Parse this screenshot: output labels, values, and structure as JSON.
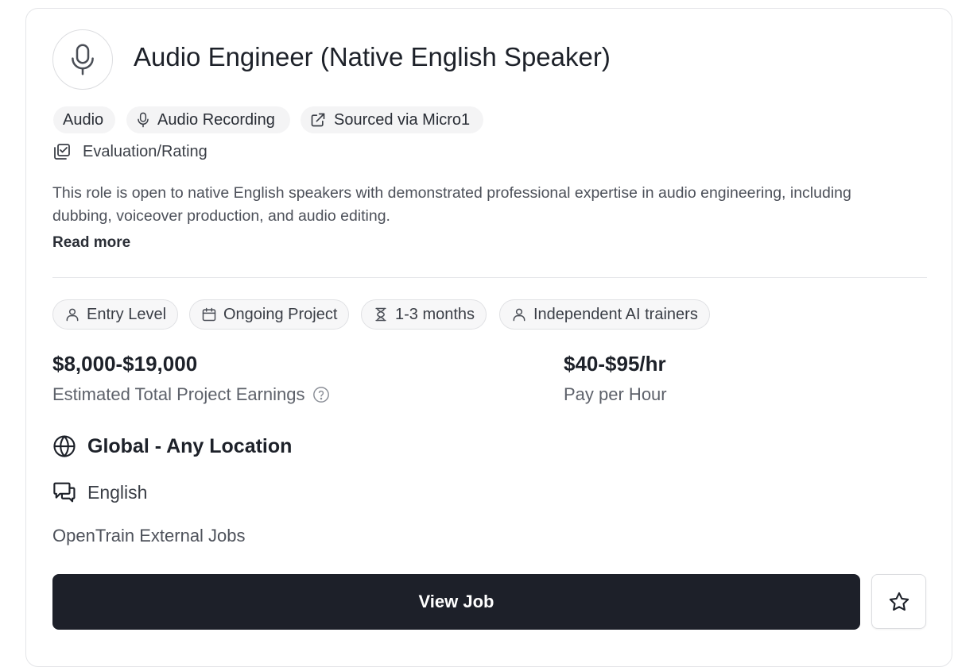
{
  "job": {
    "title": "Audio Engineer (Native English Speaker)",
    "icon": "microphone-icon"
  },
  "tags": [
    {
      "label": "Audio"
    },
    {
      "label": "Audio Recording",
      "icon": "microphone-icon"
    },
    {
      "label": "Sourced via Micro1",
      "icon": "external-link-icon"
    }
  ],
  "category": {
    "label": "Evaluation/Rating",
    "icon": "checklist-icon"
  },
  "description": {
    "text": "This role is open to native English speakers with demonstrated professional expertise in audio engineering, including dubbing, voiceover production, and audio editing.",
    "read_more": "Read more"
  },
  "details": [
    {
      "label": "Entry Level",
      "icon": "user-icon"
    },
    {
      "label": "Ongoing Project",
      "icon": "calendar-icon"
    },
    {
      "label": "1-3 months",
      "icon": "hourglass-icon"
    },
    {
      "label": "Independent AI trainers",
      "icon": "user-icon"
    }
  ],
  "earnings": {
    "total_value": "$8,000-$19,000",
    "total_label": "Estimated Total Project Earnings",
    "hourly_value": "$40-$95/hr",
    "hourly_label": "Pay per Hour",
    "help_icon": "question-circle-icon"
  },
  "location": {
    "label": "Global - Any Location",
    "icon": "globe-icon"
  },
  "language": {
    "label": "English",
    "icon": "chat-bubbles-icon"
  },
  "source": {
    "label": "OpenTrain External Jobs"
  },
  "actions": {
    "view_label": "View Job",
    "favorite_icon": "star-icon"
  },
  "colors": {
    "button_bg": "#1d2029",
    "chip_bg": "#f4f4f5",
    "border": "#e4e5e8"
  }
}
